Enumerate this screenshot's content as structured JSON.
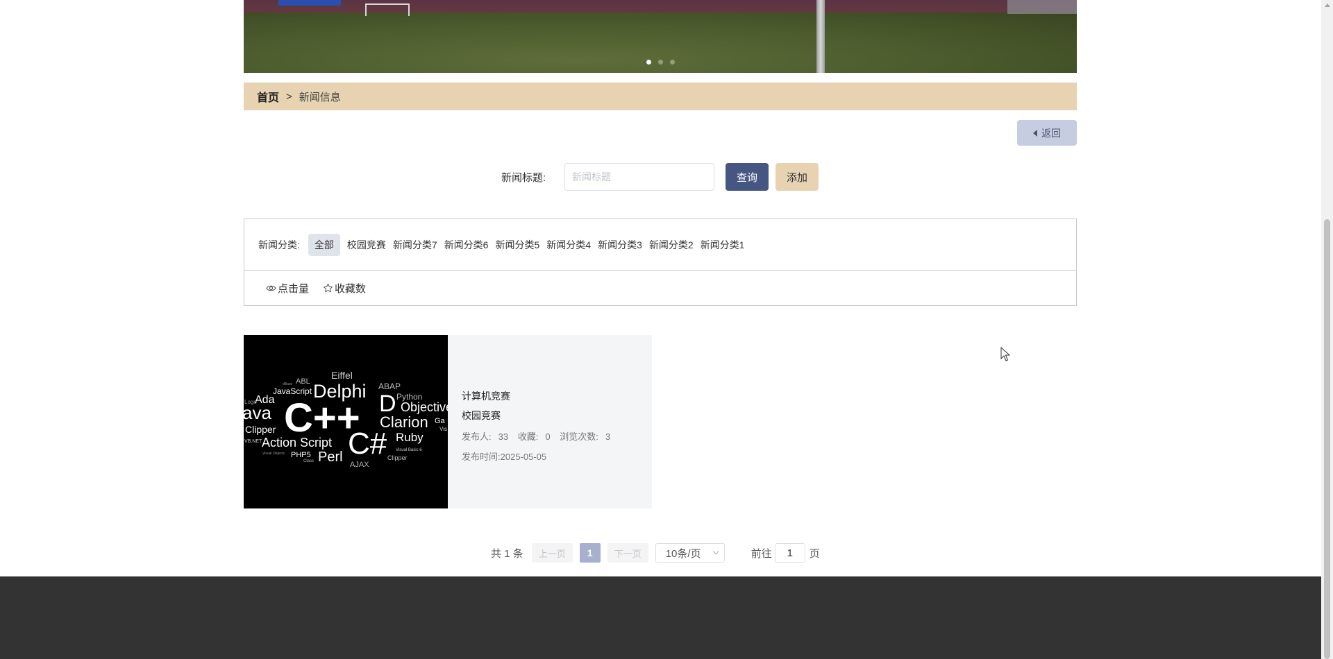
{
  "breadcrumb": {
    "home": "首页",
    "separator": ">",
    "current": "新闻信息"
  },
  "back_button": {
    "label": "返回",
    "icon": "caret-left-icon"
  },
  "search": {
    "label": "新闻标题:",
    "placeholder": "新闻标题",
    "value": "",
    "query_label": "查询",
    "add_label": "添加"
  },
  "categories": {
    "label": "新闻分类:",
    "items": [
      "全部",
      "校园竞赛",
      "新闻分类7",
      "新闻分类6",
      "新闻分类5",
      "新闻分类4",
      "新闻分类3",
      "新闻分类2",
      "新闻分类1"
    ],
    "selected": "全部"
  },
  "sort": [
    {
      "label": "点击量",
      "icon": "eye-icon"
    },
    {
      "label": "收藏数",
      "icon": "star-icon"
    }
  ],
  "news": [
    {
      "title": "计算机竞赛",
      "category": "校园竞赛",
      "publisher_label": "发布人:",
      "publisher": "33",
      "favorites_label": "收藏:",
      "favorites": "0",
      "views_label": "浏览次数:",
      "views": "3",
      "time_label": "发布时间:",
      "time": "2025-05-05",
      "thumbnail_words": [
        "Eiffel",
        "ABL",
        "ABAP",
        "JavaScript",
        "Delphi",
        "Python",
        "Ada",
        "D",
        "Objective",
        "ava",
        "C++",
        "Clarion",
        "Ga",
        "Clipper",
        "Action Script",
        "C#",
        "Ruby",
        "VB.NET",
        "PHP5",
        "Perl",
        "Visual Basic 6",
        "Clipper",
        "AJAX",
        "Visual Objects",
        "Class",
        "Vis",
        "Logo",
        "dBase"
      ]
    }
  ],
  "pagination": {
    "total_text": "共 1 条",
    "prev_label": "上一页",
    "current_page": "1",
    "next_label": "下一页",
    "page_size_label": "10条/页",
    "goto_label": "前往",
    "goto_value": "1",
    "page_unit": "页"
  },
  "colors": {
    "breadcrumb_bg": "#e7d3b2",
    "query_btn": "#465683",
    "add_btn": "#e7d3b2",
    "footer": "#333333"
  }
}
